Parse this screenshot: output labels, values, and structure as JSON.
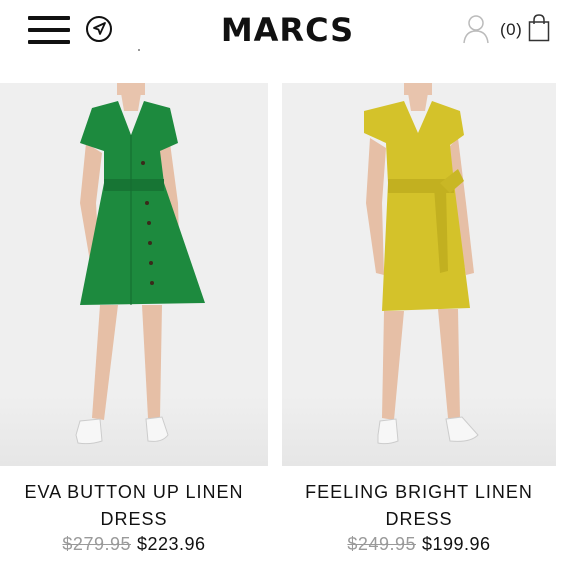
{
  "header": {
    "logo": "MARCS",
    "cart_count": "(0)",
    "icons": [
      "hamburger-menu-icon",
      "location-arrow-icon",
      "user-icon",
      "shopping-bag-icon"
    ]
  },
  "products": [
    {
      "name": "EVA BUTTON UP LINEN DRESS",
      "name_line1": "EVA BUTTON UP LINEN",
      "name_line2": "DRESS",
      "old_price": "$279.95",
      "new_price": "$223.96",
      "dress_color": "#1d8a3e"
    },
    {
      "name": "FEELING BRIGHT LINEN DRESS",
      "name_line1": "FEELING BRIGHT LINEN",
      "name_line2": "DRESS",
      "old_price": "$249.95",
      "new_price": "$199.96",
      "dress_color": "#d4c22a"
    }
  ]
}
